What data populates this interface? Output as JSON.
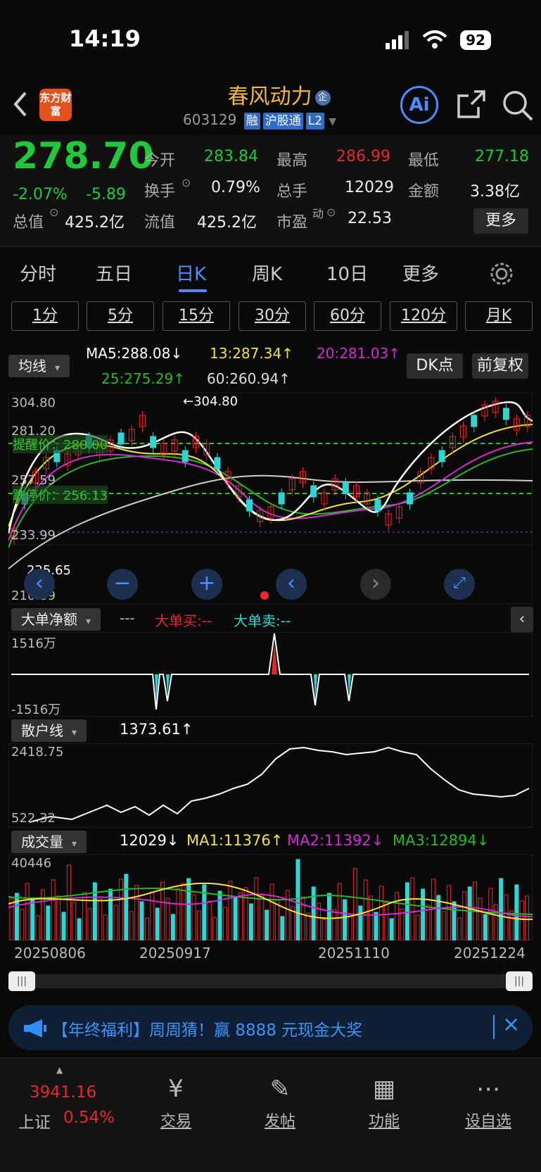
{
  "status": {
    "time": "14:19",
    "battery": "92"
  },
  "header": {
    "logo": "东方财富",
    "stock_name": "春风动力",
    "badge": "企",
    "code": "603129",
    "tags": [
      "融",
      "沪股通",
      "L2"
    ],
    "ai": "Ai"
  },
  "quote": {
    "price": "278.70",
    "change_pct": "-2.07%",
    "change": "-5.89",
    "open_label": "今开",
    "open": "283.84",
    "high_label": "最高",
    "high": "286.99",
    "low_label": "最低",
    "low": "277.18",
    "turnover_label": "换手",
    "turnover": "0.79%",
    "volume_label": "总手",
    "volume": "12029",
    "amount_label": "金额",
    "amount": "3.38亿",
    "mktcap_label": "总值",
    "mktcap": "425.2亿",
    "float_label": "流值",
    "float": "425.2亿",
    "pe_label": "市盈",
    "pe_sup": "动",
    "pe": "22.53",
    "more": "更多"
  },
  "tabs": [
    "分时",
    "五日",
    "日K",
    "周K",
    "10日",
    "更多"
  ],
  "active_tab": "日K",
  "intervals": [
    "1分",
    "5分",
    "15分",
    "30分",
    "60分",
    "120分",
    "月K"
  ],
  "ma": {
    "selector": "均线",
    "ma5": "MA5:288.08↓",
    "ma13": "13:287.34↑",
    "ma20": "20:281.03↑",
    "ma25": "25:275.29↑",
    "ma60": "60:260.94↑",
    "dk": "DK点",
    "fq": "前复权"
  },
  "kline": {
    "y_labels": [
      "304.80",
      "281.20",
      "257.59",
      "233.99",
      "210.39"
    ],
    "high_mark": "←304.80",
    "low_mark": "225.65",
    "alert_label": "提醒价：280.00",
    "stop_label": "跌停价：256.13"
  },
  "bigorder": {
    "selector": "大单净额",
    "legend_dash": "---",
    "buy": "大单买:--",
    "sell": "大单卖:--",
    "top": "1516万",
    "bottom": "-1516万"
  },
  "retail": {
    "selector": "散户线",
    "value": "1373.61↑",
    "top": "2418.75",
    "bottom": "522.32"
  },
  "volume": {
    "selector": "成交量",
    "value": "12029↓",
    "ma1": "MA1:11376↑",
    "ma2": "MA2:11392↓",
    "ma3": "MA3:12894↓",
    "top": "40446",
    "dates": [
      "20250806",
      "20250917",
      "20251110",
      "20251224"
    ]
  },
  "banner": {
    "text": "【年终福利】周周猜！赢 8888 元现金大奖"
  },
  "tabbar": {
    "index_value": "3941.16",
    "index_name": "上证",
    "index_pct": "0.54%",
    "items": [
      "交易",
      "发帖",
      "功能",
      "设自选"
    ]
  },
  "chart_data": {
    "type": "candlestick",
    "y_range": [
      210.39,
      304.8
    ],
    "levels": {
      "alert": 280.0,
      "limit_down": 256.13
    },
    "volume_max": 40446,
    "retail_range": [
      522.32,
      2418.75
    ]
  }
}
